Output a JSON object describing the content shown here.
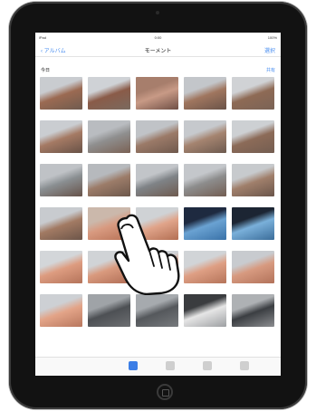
{
  "status_bar": {
    "carrier": "iPad",
    "time": "0:00",
    "battery": "100%"
  },
  "nav": {
    "back_label": "アルバム",
    "title": "モーメント",
    "right_label": "選択"
  },
  "section": {
    "label": "今日",
    "select_label": "共有"
  },
  "photos": [
    {
      "sky": "#c9ccd0",
      "ground": "#6f5b4f",
      "accent": "#9b6a52"
    },
    {
      "sky": "#cfd2d6",
      "ground": "#7a6a5f",
      "accent": "#8a5b48"
    },
    {
      "sky": "#a77e6c",
      "ground": "#6f4f45",
      "accent": "#c89a86"
    },
    {
      "sky": "#c3c6ca",
      "ground": "#6a5348",
      "accent": "#a0765f"
    },
    {
      "sky": "#d0d2d5",
      "ground": "#7a6356",
      "accent": "#8e6a55"
    },
    {
      "sky": "#cacdd1",
      "ground": "#685247",
      "accent": "#a57a64"
    },
    {
      "sky": "#b9bcc0",
      "ground": "#7a6154",
      "accent": "#8f8f8f"
    },
    {
      "sky": "#c0c3c7",
      "ground": "#6f594d",
      "accent": "#9b7a68"
    },
    {
      "sky": "#c6c9cd",
      "ground": "#6d5a4f",
      "accent": "#a58470"
    },
    {
      "sky": "#cdd0d3",
      "ground": "#735d51",
      "accent": "#8c6b58"
    },
    {
      "sky": "#bfc2c6",
      "ground": "#665249",
      "accent": "#8a8f92"
    },
    {
      "sky": "#b6b9bd",
      "ground": "#6c574b",
      "accent": "#9c7c69"
    },
    {
      "sky": "#c2c5c9",
      "ground": "#6e5a4f",
      "accent": "#7f8387"
    },
    {
      "sky": "#c4c7cb",
      "ground": "#725d52",
      "accent": "#8d8d8d"
    },
    {
      "sky": "#c7cacd",
      "ground": "#6a554a",
      "accent": "#a07f6b"
    },
    {
      "sky": "#c8cbcf",
      "ground": "#6c5549",
      "accent": "#a27a63"
    },
    {
      "sky": "#cbb8ab",
      "ground": "#b77155",
      "accent": "#d89a80"
    },
    {
      "sky": "#cfd2d5",
      "ground": "#b36f53",
      "accent": "#e0a48a"
    },
    {
      "sky": "#1e2a40",
      "ground": "#3a72a8",
      "accent": "#6aa2d2"
    },
    {
      "sky": "#1c2533",
      "ground": "#3b6d9a",
      "accent": "#7ab0da"
    },
    {
      "sky": "#d3d6d9",
      "ground": "#b4735a",
      "accent": "#dd9c80"
    },
    {
      "sky": "#d0d3d6",
      "ground": "#b06d55",
      "accent": "#d99a7e"
    },
    {
      "sky": "#cfd2d6",
      "ground": "#b37058",
      "accent": "#dc9c82"
    },
    {
      "sky": "#d1d4d7",
      "ground": "#b5745a",
      "accent": "#de9f84"
    },
    {
      "sky": "#c8cbcf",
      "ground": "#b2725a",
      "accent": "#d79a80"
    },
    {
      "sky": "#cdd0d4",
      "ground": "#b8775e",
      "accent": "#e3a488"
    },
    {
      "sky": "#9fa3a7",
      "ground": "#6d6f72",
      "accent": "#4d5054"
    },
    {
      "sky": "#a6aaae",
      "ground": "#777a7d",
      "accent": "#55585c"
    },
    {
      "sky": "#3a3c3f",
      "ground": "#9d9fa2",
      "accent": "#e6e6e6"
    },
    {
      "sky": "#aeb1b4",
      "ground": "#8b8d90",
      "accent": "#3b3e42"
    }
  ],
  "tabs": [
    {
      "color": "#3b7ee6"
    },
    {
      "color": "#cfcfcf"
    },
    {
      "color": "#cfcfcf"
    },
    {
      "color": "#cfcfcf"
    }
  ]
}
